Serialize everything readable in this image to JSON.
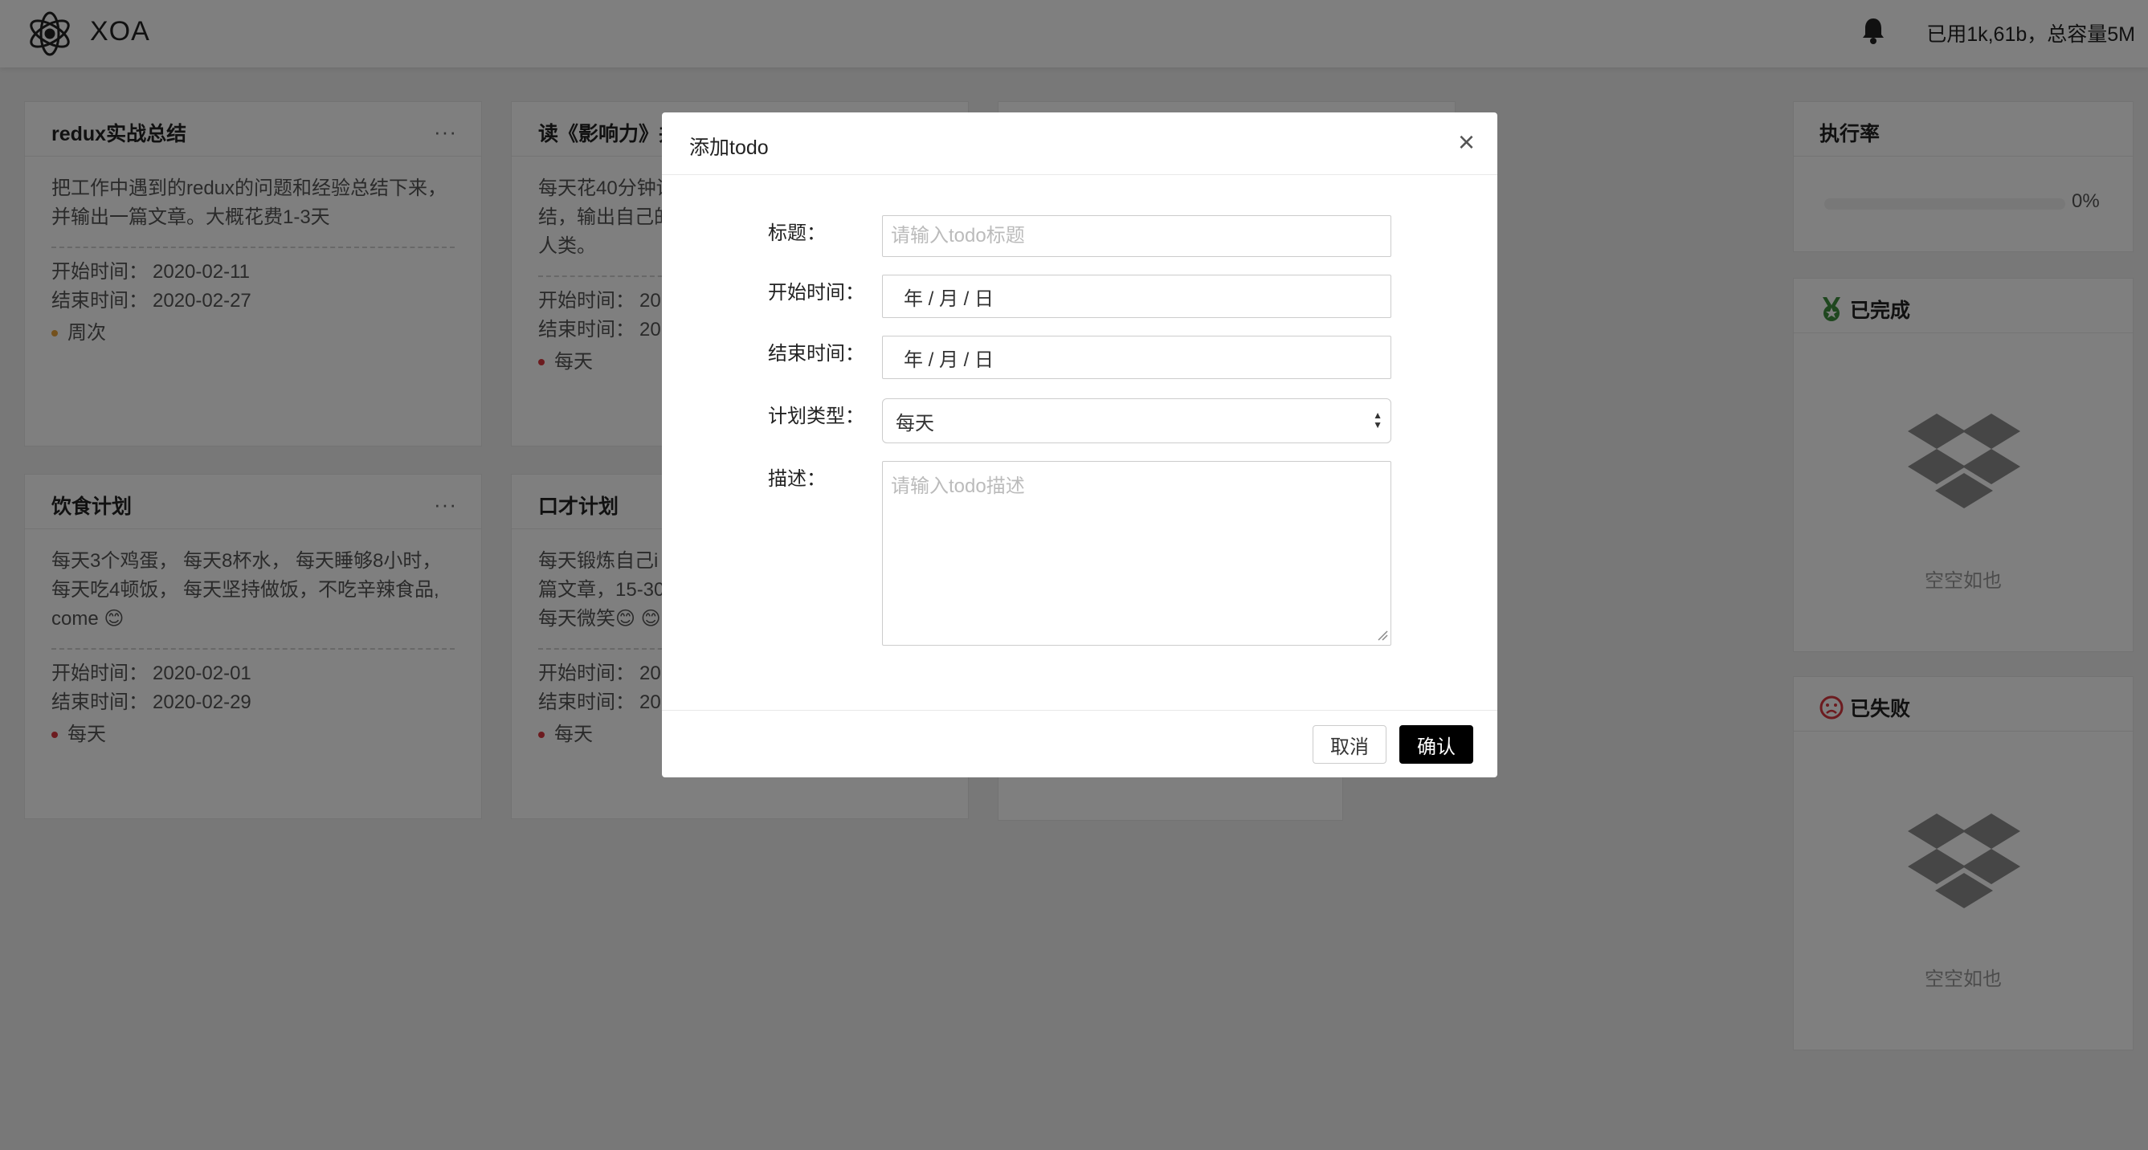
{
  "header": {
    "app_name": "XOA",
    "storage_text": "已用1k,61b，总容量5M"
  },
  "cards": [
    {
      "title": "redux实战总结",
      "more": "···",
      "description_lines": [
        "把工作中遇到的redux的问题和经验总结下来，",
        "并输出一篇文章。大概花费1-3天"
      ],
      "start_label": "开始时间：",
      "start_value": "2020-02-11",
      "end_label": "结束时间：",
      "end_value": "2020-02-27",
      "tag": "周次",
      "tag_color": "#e8a23a"
    },
    {
      "title": "读《影响力》并",
      "more": "···",
      "description_lines": [
        "每天花40分钟读",
        "结，输出自己的",
        "人类。"
      ],
      "start_label": "开始时间：",
      "start_value": "20",
      "end_label": "结束时间：",
      "end_value": "20",
      "tag": "每天",
      "tag_color": "#d9363e"
    },
    {
      "title": "饮食计划",
      "more": "···",
      "description_lines": [
        "每天3个鸡蛋， 每天8杯水， 每天睡够8小时，",
        "每天吃4顿饭， 每天坚持做饭，不吃辛辣食品,",
        "come 😊"
      ],
      "start_label": "开始时间：",
      "start_value": "2020-02-01",
      "end_label": "结束时间：",
      "end_value": "2020-02-29",
      "tag": "每天",
      "tag_color": "#d9363e"
    },
    {
      "title": "口才计划",
      "more": "···",
      "description_lines": [
        "每天锻炼自己i",
        "篇文章，15-30",
        "每天微笑😊 😊"
      ],
      "start_label": "开始时间：",
      "start_value": "20",
      "end_label": "结束时间：",
      "end_value": "20",
      "tag": "每天",
      "tag_color": "#d9363e"
    }
  ],
  "right_panels": {
    "rate": {
      "title": "执行率",
      "percent_label": "0%",
      "progress": 0
    },
    "done": {
      "title": "已完成",
      "empty_text": "空空如也"
    },
    "failed": {
      "title": "已失败",
      "empty_text": "空空如也"
    }
  },
  "modal": {
    "title": "添加todo",
    "close": "×",
    "fields": {
      "title_label": "标题：",
      "title_placeholder": "请输入todo标题",
      "start_label": "开始时间：",
      "start_value": "年  / 月 / 日",
      "end_label": "结束时间：",
      "end_value": "年  / 月 / 日",
      "type_label": "计划类型：",
      "type_value": "每天",
      "desc_label": "描述：",
      "desc_placeholder": "请输入todo描述"
    },
    "cancel_label": "取消",
    "ok_label": "确认"
  }
}
